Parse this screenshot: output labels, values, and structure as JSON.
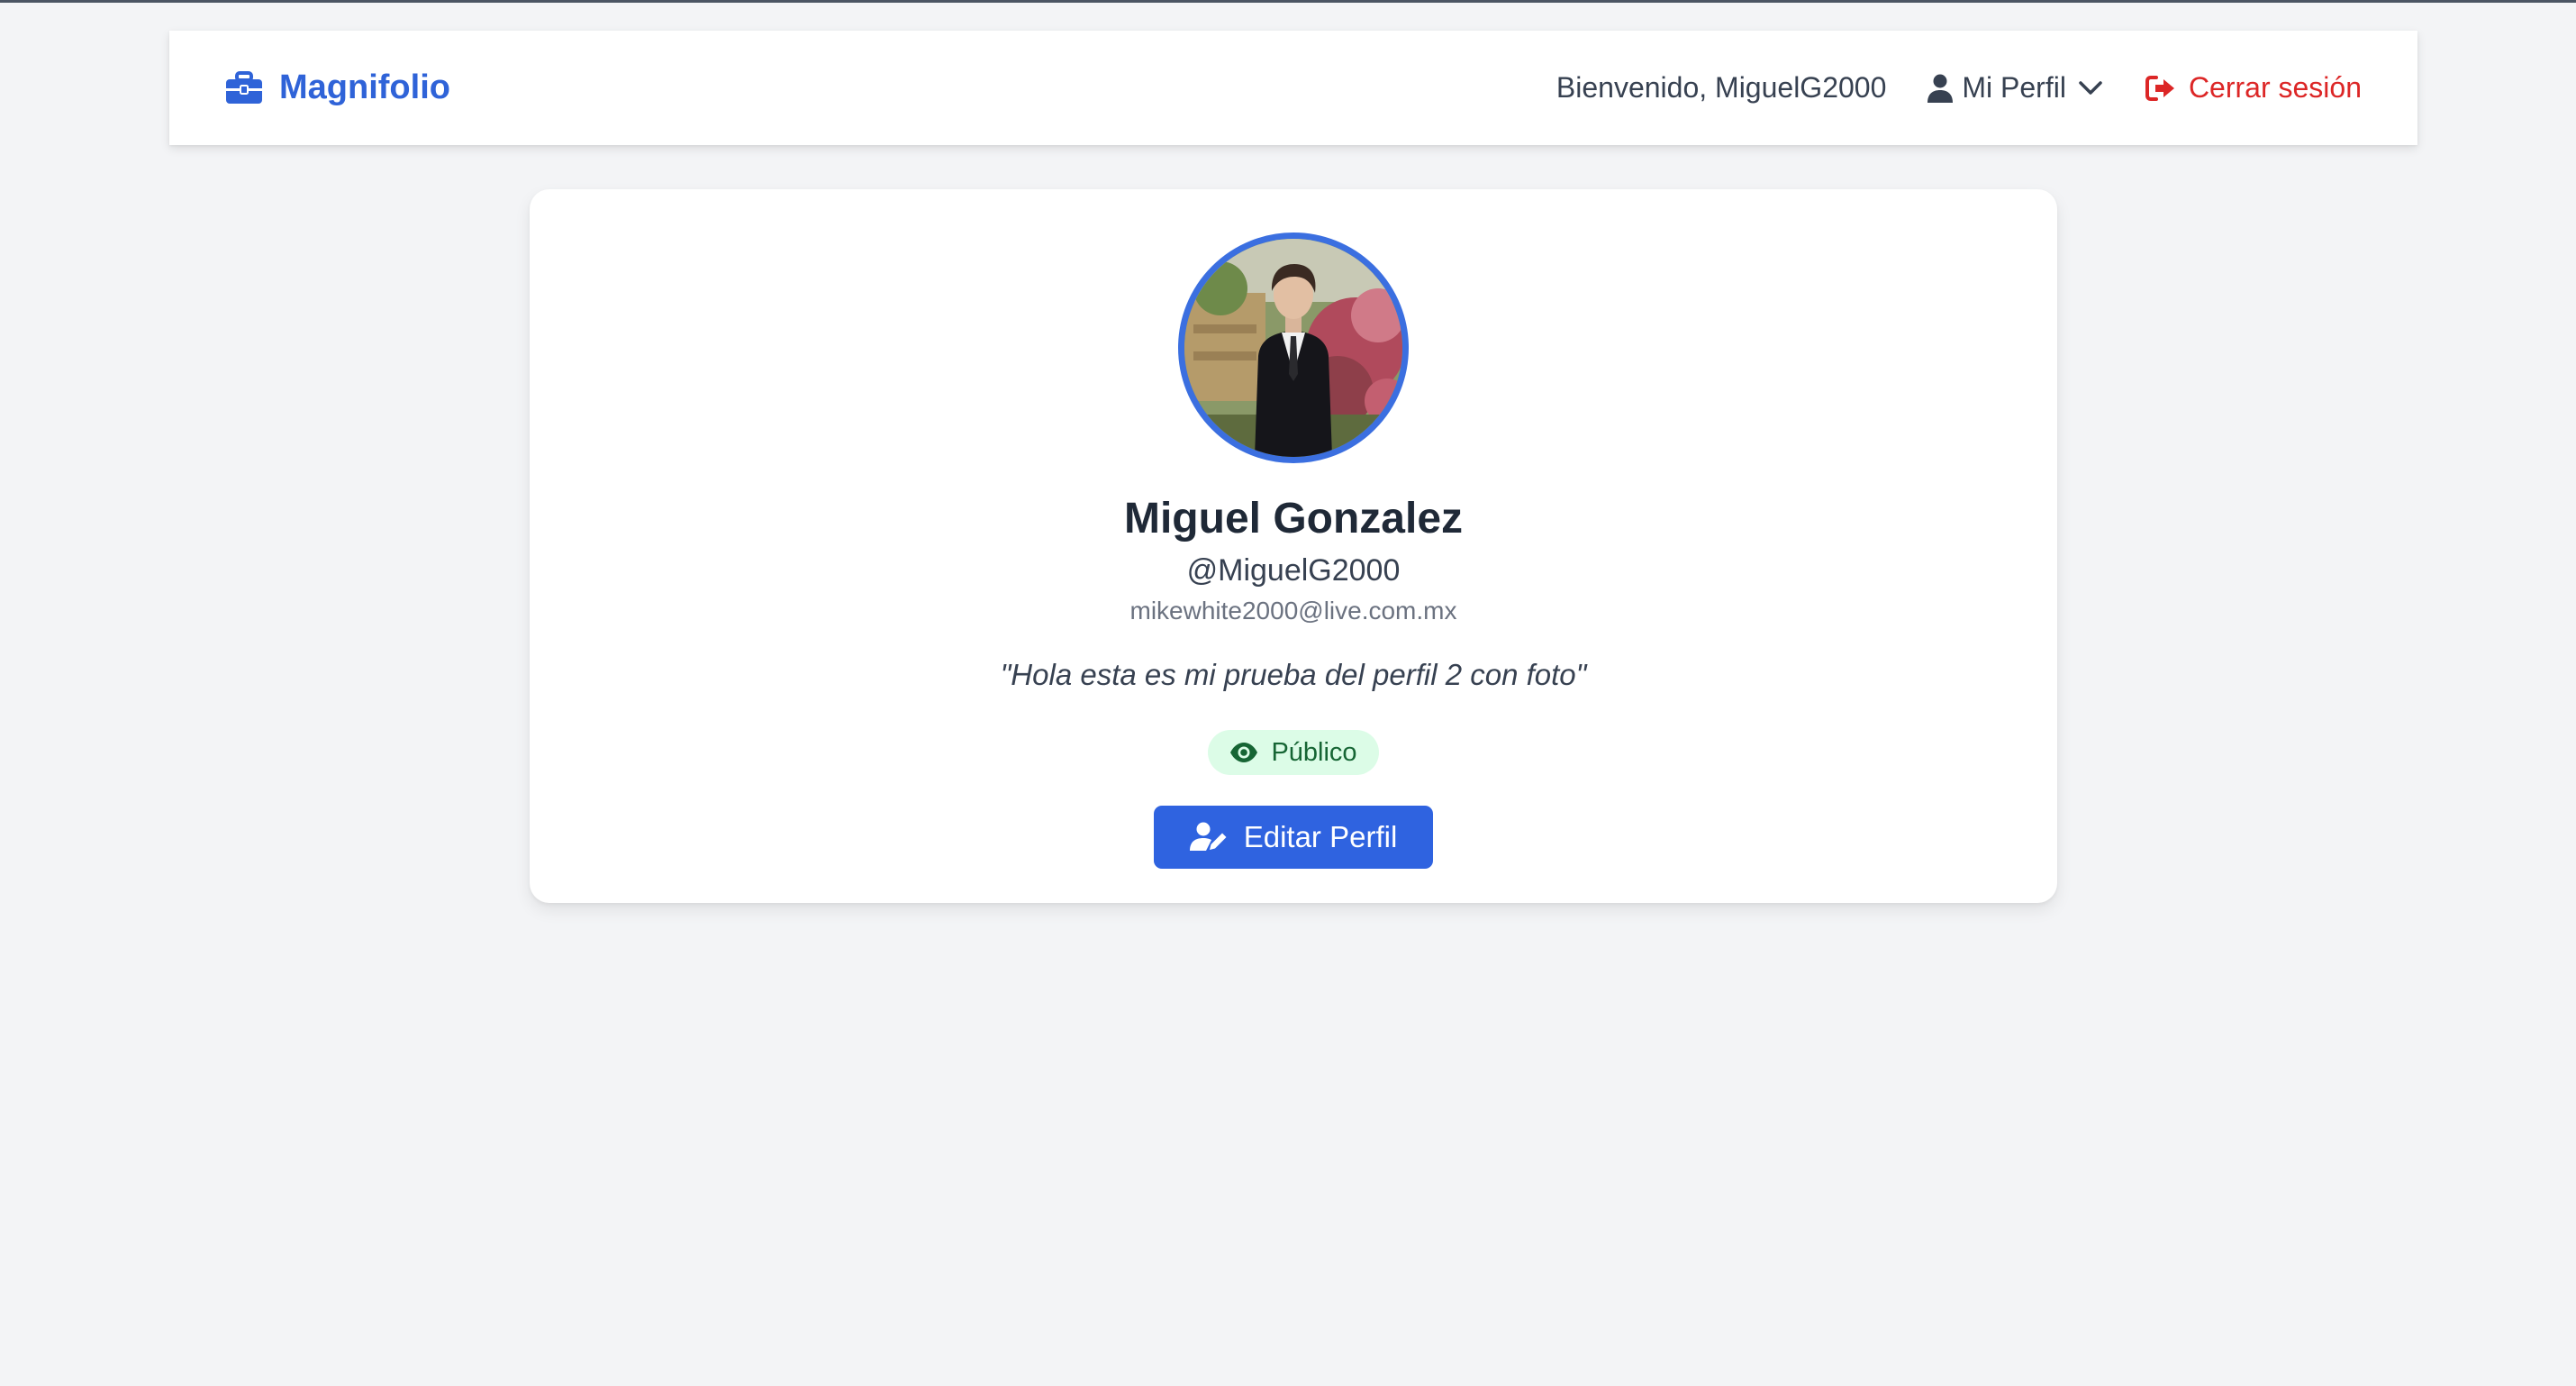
{
  "navbar": {
    "brand": "Magnifolio",
    "welcome": "Bienvenido, MiguelG2000",
    "profile_menu": "Mi Perfil",
    "logout": "Cerrar sesión"
  },
  "profile": {
    "name": "Miguel Gonzalez",
    "handle": "@MiguelG2000",
    "email": "mikewhite2000@live.com.mx",
    "bio": "\"Hola esta es mi prueba del perfil 2 con foto\"",
    "visibility": "Público",
    "edit_button": "Editar Perfil"
  },
  "colors": {
    "brand": "#2f63d8",
    "logout": "#dc2626",
    "badge_bg": "#dcfce7",
    "badge_text": "#166534",
    "button": "#2f63e0",
    "avatar_border": "#3b6fe0"
  },
  "icons": {
    "brand": "briefcase-icon",
    "profile": "user-icon",
    "menu": "chevron-down-icon",
    "logout": "sign-out-icon",
    "visibility": "eye-icon",
    "edit": "user-edit-icon"
  }
}
